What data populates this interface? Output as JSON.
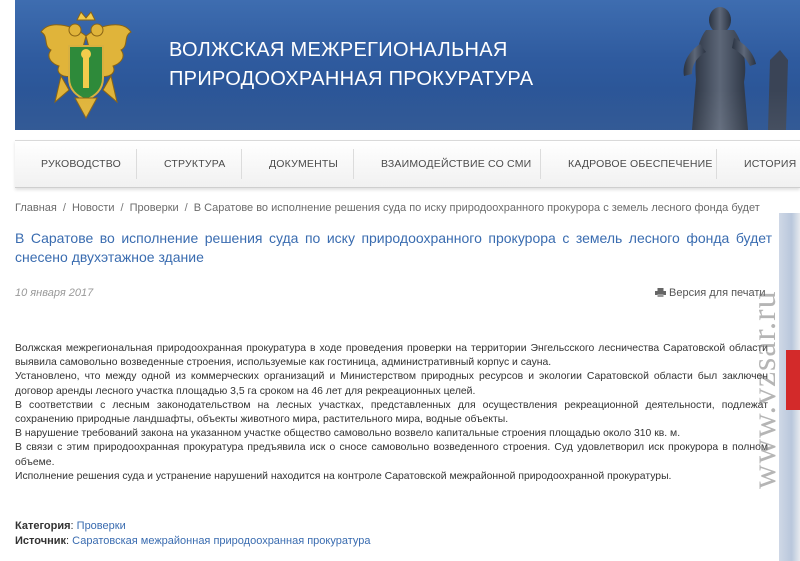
{
  "header": {
    "title_line1": "ВОЛЖСКАЯ МЕЖРЕГИОНАЛЬНАЯ",
    "title_line2": "ПРИРОДООХРАННАЯ ПРОКУРАТУРА"
  },
  "nav": {
    "items": [
      "РУКОВОДСТВО",
      "СТРУКТУРА",
      "ДОКУМЕНТЫ",
      "ВЗАИМОДЕЙСТВИЕ СО СМИ",
      "КАДРОВОЕ ОБЕСПЕЧЕНИЕ",
      "ИСТОРИЯ"
    ]
  },
  "breadcrumb": {
    "items": [
      "Главная",
      "Новости",
      "Проверки"
    ],
    "separator": "/",
    "current": "В Саратове во исполнение решения суда по иску природоохранного прокурора с земель лесного фонда будет"
  },
  "article": {
    "title": "В Саратове во исполнение решения суда по иску природоохранного прокурора с земель лесного фонда будет снесено двухэтажное здание",
    "date": "10 января 2017",
    "print_label": "Версия для печати",
    "paragraphs": [
      "Волжская межрегиональная природоохранная прокуратура в ходе проведения проверки на территории Энгельсского лесничества Саратовской области выявила самовольно возведенные строения, используемые как гостиница, административный корпус и сауна.",
      "Установлено, что между одной из коммерческих организаций и Министерством природных ресурсов и экологии Саратовской области был заключен договор аренды лесного участка площадью 3,5 га сроком на 46 лет для рекреационных целей.",
      "В соответствии с лесным законодательством на лесных участках, представленных для осуществления рекреационной деятельности, подлежат сохранению природные ландшафты, объекты животного мира, растительного мира, водные объекты.",
      "В нарушение требований закона на указанном участке общество самовольно возвело капитальные строения площадью около 310 кв. м.",
      "В связи с этим природоохранная прокуратура предъявила иск о сносе самовольно возведенного строения. Суд удовлетворил иск прокурора в полном объеме.",
      "Исполнение решения суда и устранение нарушений находится на контроле Саратовской межрайонной природоохранной прокуратуры."
    ],
    "category_label": "Категория",
    "category_value": "Проверки",
    "source_label": "Источник",
    "source_value": "Саратовская межрайонная природоохранная прокуратура"
  },
  "watermark": "www.vzsar.ru",
  "icons": [
    "emblem-eagle-icon",
    "statue-icon",
    "printer-icon"
  ],
  "colors": {
    "header_blue": "#2f5b9f",
    "link_blue": "#3a6cb0",
    "edge_red": "#d32a2a"
  }
}
